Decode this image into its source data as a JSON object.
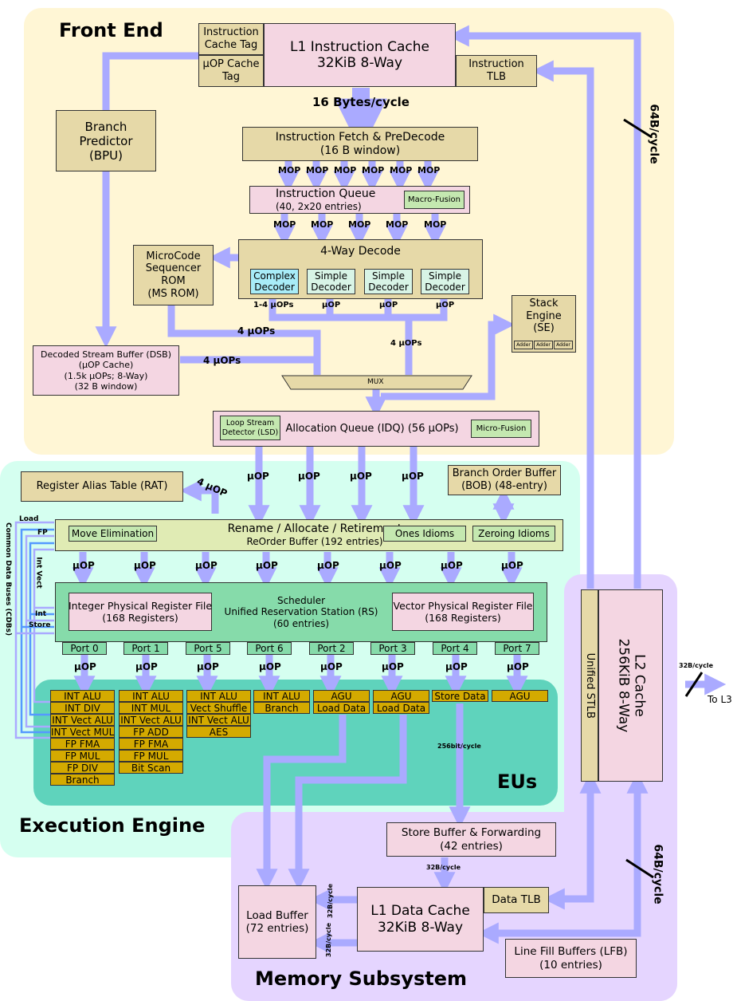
{
  "regions": {
    "front_end": "Front End",
    "execution_engine": "Execution Engine",
    "eus": "EUs",
    "memory_subsystem": "Memory Subsystem"
  },
  "front_end": {
    "instruction_cache_tag": [
      "Instruction",
      "Cache Tag"
    ],
    "uop_cache_tag": [
      "µOP Cache",
      "Tag"
    ],
    "l1i": [
      "L1 Instruction Cache",
      "32KiB 8-Way"
    ],
    "itlb": [
      "Instruction",
      "TLB"
    ],
    "fetch_bw": "16 Bytes/cycle",
    "bpu": [
      "Branch",
      "Predictor",
      "(BPU)"
    ],
    "fetch": [
      "Instruction Fetch & PreDecode",
      "(16 B window)"
    ],
    "mop_row1": [
      "MOP",
      "MOP",
      "MOP",
      "MOP",
      "MOP",
      "MOP"
    ],
    "iq": [
      "Instruction Queue",
      "(40, 2x20 entries)"
    ],
    "macro_fusion": "Macro-Fusion",
    "mop_row2": [
      "MOP",
      "MOP",
      "MOP",
      "MOP",
      "MOP"
    ],
    "msrom": [
      "MicroCode",
      "Sequencer",
      "ROM",
      "(MS ROM)"
    ],
    "decode": "4-Way Decode",
    "decoders": [
      {
        "l1": "Complex",
        "l2": "Decoder",
        "kind": "complex"
      },
      {
        "l1": "Simple",
        "l2": "Decoder",
        "kind": "simple"
      },
      {
        "l1": "Simple",
        "l2": "Decoder",
        "kind": "simple"
      },
      {
        "l1": "Simple",
        "l2": "Decoder",
        "kind": "simple"
      }
    ],
    "decoder_outputs": [
      "1-4 µOPs",
      "µOP",
      "µOP",
      "µOP"
    ],
    "msrom_bw": "4 µOPs",
    "decode_bw": "4 µOPs",
    "dsb_bw": "4 µOPs",
    "dsb": [
      "Decoded Stream Buffer (DSB)",
      "(µOP Cache)",
      "(1.5k µOPs; 8-Way)",
      "(32 B window)"
    ],
    "stack_engine": [
      "Stack",
      "Engine",
      "(SE)"
    ],
    "adders": [
      "Adder",
      "Adder",
      "Adder"
    ],
    "mux": "MUX",
    "idq": "Allocation Queue (IDQ) (56 µOPs)",
    "lsd": [
      "Loop Stream",
      "Detector (LSD)"
    ],
    "micro_fusion": "Micro-Fusion",
    "l2_bw_top": "64B/cycle"
  },
  "execution": {
    "rat": "Register Alias Table (RAT)",
    "rat_bw": "4 µOP",
    "idq_out": [
      "µOP",
      "µOP",
      "µOP",
      "µOP"
    ],
    "bob": [
      "Branch Order Buffer",
      "(BOB) (48-entry)"
    ],
    "rob": [
      "Rename / Allocate / Retirement",
      "ReOrder Buffer (192 entries)"
    ],
    "move_elim": "Move Elimination",
    "ones_idioms": "Ones Idioms",
    "zeroing_idioms": "Zeroing Idioms",
    "rob_out": [
      "µOP",
      "µOP",
      "µOP",
      "µOP",
      "µOP",
      "µOP",
      "µOP",
      "µOP"
    ],
    "scheduler": [
      "Scheduler",
      "Unified Reservation Station (RS)",
      "(60 entries)"
    ],
    "int_prf": [
      "Integer Physical Register File",
      "(168 Registers)"
    ],
    "vec_prf": [
      "Vector Physical Register File",
      "(168 Registers)"
    ],
    "ports": [
      "Port 0",
      "Port 1",
      "Port 5",
      "Port 6",
      "Port 2",
      "Port 3",
      "Port 4",
      "Port 7"
    ],
    "port_out": [
      "µOP",
      "µOP",
      "µOP",
      "µOP",
      "µOP",
      "µOP",
      "µOP",
      "µOP"
    ],
    "eu_columns": [
      [
        "INT ALU",
        "INT DIV",
        "INT Vect ALU",
        "INT Vect MUL",
        "FP FMA",
        "FP MUL",
        "FP DIV",
        "Branch"
      ],
      [
        "INT ALU",
        "INT MUL",
        "INT Vect ALU",
        "FP ADD",
        "FP FMA",
        "FP MUL",
        "Bit Scan"
      ],
      [
        "INT ALU",
        "Vect Shuffle",
        "INT Vect ALU",
        "AES"
      ],
      [
        "INT ALU",
        "Branch"
      ],
      [
        "AGU",
        "Load Data"
      ],
      [
        "AGU",
        "Load Data"
      ],
      [
        "Store Data"
      ],
      [
        "AGU"
      ]
    ],
    "store_bw": "256bit/cycle",
    "cdb_title": "Common Data Buses (CDBs)",
    "cdb_labels": {
      "load": "Load",
      "fp": "FP",
      "int_vect": "Int Vect",
      "int": "Int",
      "store": "Store"
    }
  },
  "memory": {
    "stlb": "Unified STLB",
    "l2": [
      "L2 Cache",
      "256KiB 8-Way"
    ],
    "l3_bw": "32B/cycle",
    "to_l3": "To L3",
    "store_buffer": [
      "Store Buffer & Forwarding",
      "(42 entries)"
    ],
    "sb_bw": "32B/cycle",
    "load_buffer": [
      "Load Buffer",
      "(72 entries)"
    ],
    "lb_bw": [
      "32B/cycle",
      "32B/cycle"
    ],
    "l1d": [
      "L1 Data Cache",
      "32KiB 8-Way"
    ],
    "dtlb": "Data TLB",
    "lfb": [
      "Line Fill Buffers (LFB)",
      "(10 entries)"
    ],
    "l2_bw_bottom": "64B/cycle"
  },
  "colors": {
    "wire": "#aaaaff",
    "front_end_bg": "#fff6d5",
    "execution_bg": "#d5fff0",
    "eus_bg": "#5fd3bc",
    "memory_bg": "#e5d5ff",
    "eu_unit": "#d4aa00"
  }
}
